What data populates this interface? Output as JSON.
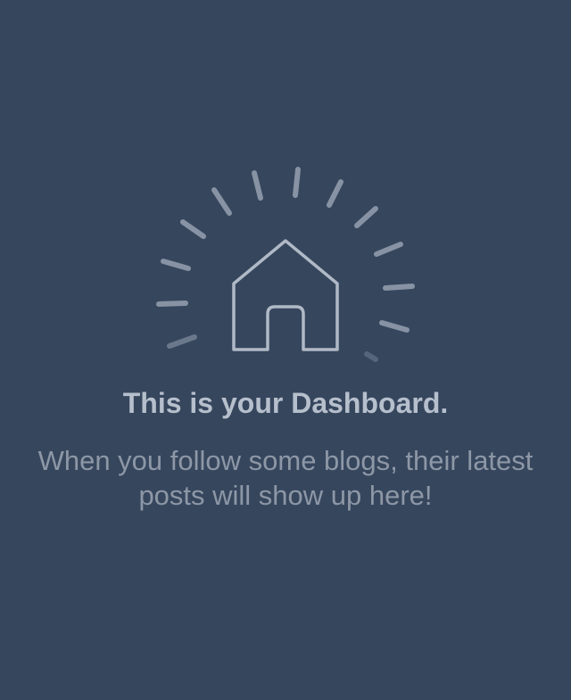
{
  "dashboard": {
    "title": "This is your Dashboard.",
    "subtitle": "When you follow some blogs, their latest posts will show up here!"
  },
  "icons": {
    "illustration": "home-icon-with-rays"
  },
  "colors": {
    "background": "#36465d",
    "title_text": "#b6bfcc",
    "subtitle_text": "#8d97a6",
    "icon_stroke": "#b0b9c6",
    "rays": "#8793a4"
  }
}
